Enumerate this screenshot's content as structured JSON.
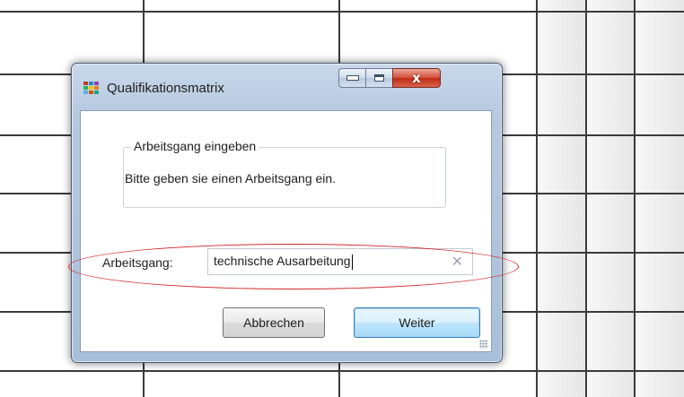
{
  "window": {
    "title": "Qualifikationsmatrix",
    "icon": "app-palette-icon"
  },
  "caption_buttons": {
    "minimize_icon": "minimize-icon",
    "maximize_icon": "maximize-icon",
    "close_glyph": "x"
  },
  "groupbox": {
    "header": "Arbeitsgang eingeben",
    "text": "Bitte geben sie einen Arbeitsgang ein."
  },
  "field": {
    "label": "Arbeitsgang:",
    "value": "technische Ausarbeitung",
    "clear_glyph": "✕"
  },
  "buttons": {
    "cancel": "Abbrechen",
    "next": "Weiter"
  },
  "colors": {
    "highlight": "#d1282b",
    "close_button": "#c9361f",
    "default_button_border": "#3c7fb1"
  }
}
